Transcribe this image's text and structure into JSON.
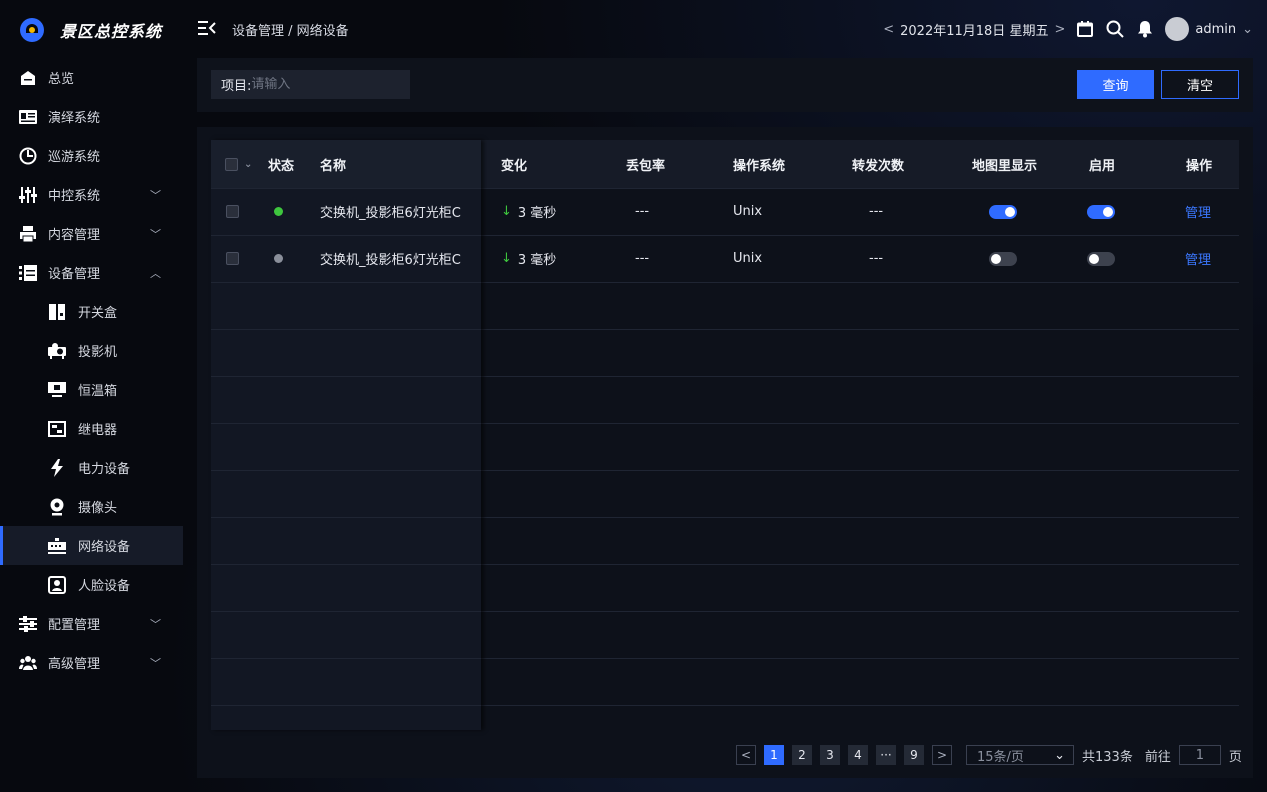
{
  "app": {
    "title": "景区总控系统"
  },
  "breadcrumb": "设备管理 / 网络设备",
  "header": {
    "date": "2022年11月18日 星期五",
    "user": "admin"
  },
  "sidebar": {
    "items": [
      {
        "label": "总览",
        "icon": "home-icon"
      },
      {
        "label": "演绎系统",
        "icon": "id-card-icon"
      },
      {
        "label": "巡游系统",
        "icon": "compass-icon"
      },
      {
        "label": "中控系统",
        "icon": "sliders-icon",
        "expandable": true
      },
      {
        "label": "内容管理",
        "icon": "printer-icon",
        "expandable": true
      },
      {
        "label": "设备管理",
        "icon": "device-list-icon",
        "expanded": true
      }
    ],
    "sub_items": [
      {
        "label": "开关盒",
        "icon": "switch-box-icon"
      },
      {
        "label": "投影机",
        "icon": "projector-icon"
      },
      {
        "label": "恒温箱",
        "icon": "thermostat-box-icon"
      },
      {
        "label": "继电器",
        "icon": "relay-icon"
      },
      {
        "label": "电力设备",
        "icon": "lightning-icon"
      },
      {
        "label": "摄像头",
        "icon": "camera-icon"
      },
      {
        "label": "网络设备",
        "icon": "network-device-icon",
        "active": true
      },
      {
        "label": "人脸设备",
        "icon": "face-device-icon"
      }
    ],
    "bottom_items": [
      {
        "label": "配置管理",
        "icon": "config-icon",
        "expandable": true
      },
      {
        "label": "高级管理",
        "icon": "users-icon",
        "expandable": true
      }
    ]
  },
  "filter": {
    "field_label": "项目:",
    "placeholder": "请输入",
    "query_button": "查询",
    "clear_button": "清空"
  },
  "table": {
    "columns": [
      "状态",
      "名称",
      "变化",
      "丢包率",
      "操作系统",
      "转发次数",
      "地图里显示",
      "启用",
      "操作"
    ],
    "rows": [
      {
        "status": "online",
        "status_color": "#3ec63e",
        "name": "交换机_投影柜6灯光柜C",
        "change": "3 毫秒",
        "loss": "---",
        "os": "Unix",
        "forwards": "---",
        "show_on_map": true,
        "enabled": true,
        "action": "管理"
      },
      {
        "status": "offline",
        "status_color": "#8a8f9a",
        "name": "交换机_投影柜6灯光柜C",
        "change": "3 毫秒",
        "loss": "---",
        "os": "Unix",
        "forwards": "---",
        "show_on_map": false,
        "enabled": false,
        "action": "管理"
      }
    ]
  },
  "pagination": {
    "pages": [
      "1",
      "2",
      "3",
      "4"
    ],
    "ellipsis": "···",
    "last_page": "9",
    "current": "1",
    "page_size": "15条/页",
    "total": "共133条",
    "goto_label": "前往",
    "goto_value": "1",
    "page_unit": "页"
  },
  "colors": {
    "accent": "#2f6bff",
    "online": "#3ec63e",
    "offline": "#8a8f9a"
  }
}
